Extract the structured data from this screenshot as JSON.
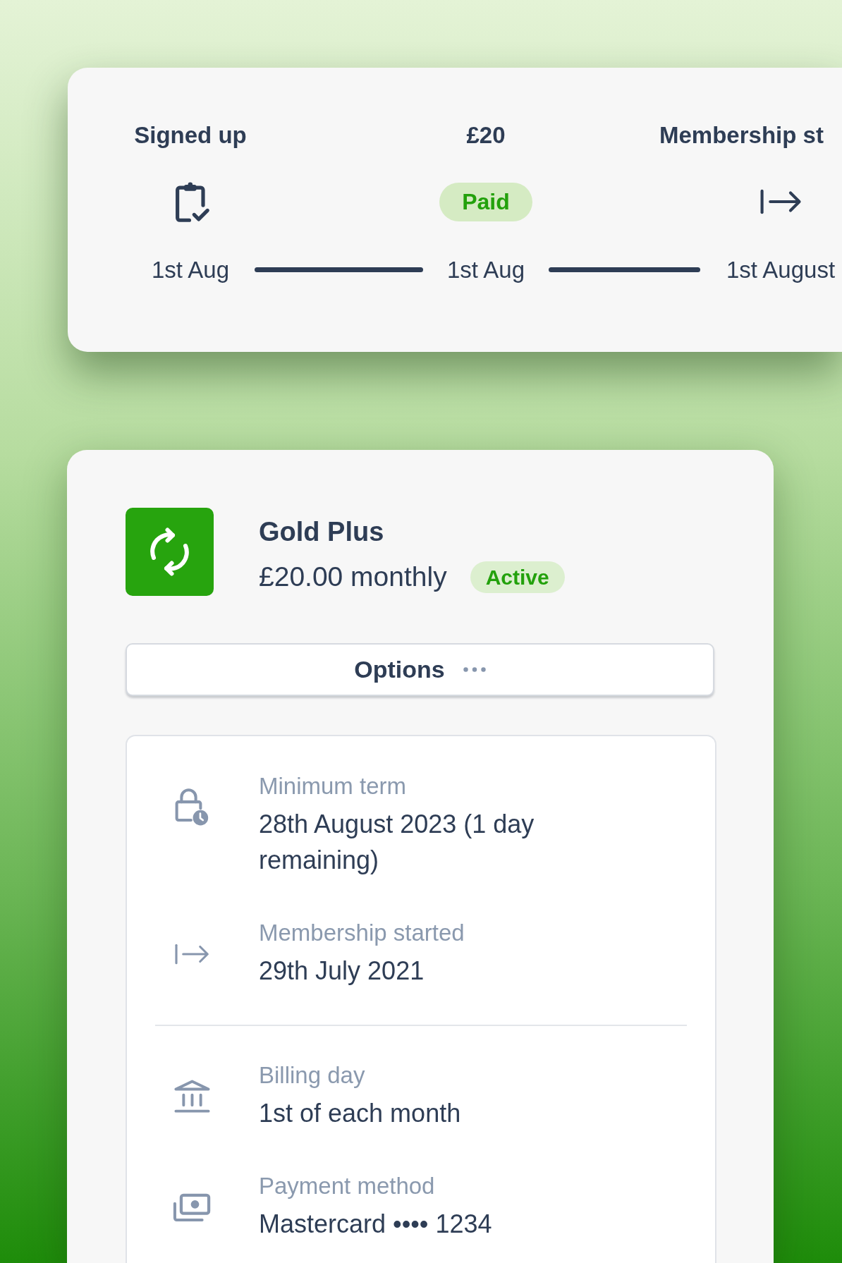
{
  "timeline": {
    "steps": [
      {
        "kind": "icon",
        "title": "Signed up",
        "date": "1st Aug"
      },
      {
        "kind": "badge",
        "title": "£20",
        "badge": "Paid",
        "date": "1st Aug"
      },
      {
        "kind": "icon",
        "title": "Membership st",
        "date": "1st August"
      }
    ]
  },
  "plan": {
    "name": "Gold Plus",
    "price": "£20.00 monthly",
    "status": "Active",
    "options": "Options",
    "detail_groups": [
      {
        "items": [
          {
            "label": "Minimum term",
            "value": "28th August 2023 (1 day remaining)"
          },
          {
            "label": "Membership started",
            "value": "29th July 2021"
          }
        ]
      },
      {
        "items": [
          {
            "label": "Billing day",
            "value": "1st of each month"
          },
          {
            "label": "Payment method",
            "value": "Mastercard •••• 1234"
          }
        ]
      }
    ]
  }
}
